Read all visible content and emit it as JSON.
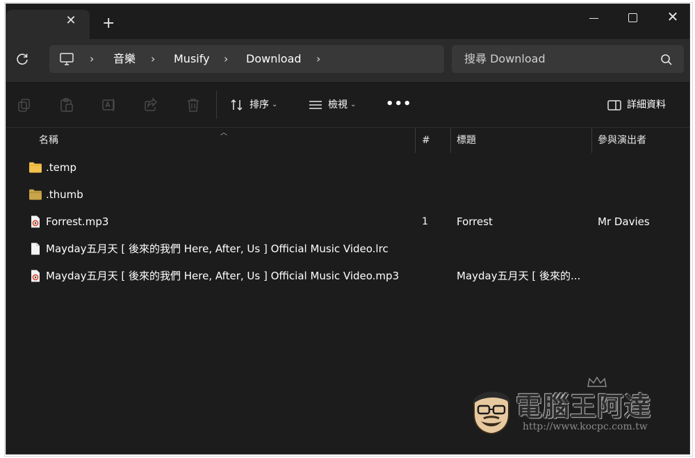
{
  "window": {
    "tab_close": "✕",
    "new_tab": "+",
    "close_glyph": "✕"
  },
  "breadcrumb": {
    "items": [
      "音樂",
      "Musify",
      "Download"
    ],
    "separator": "›"
  },
  "search": {
    "placeholder": "搜尋 Download"
  },
  "toolbar": {
    "sort_label": "排序",
    "view_label": "檢視",
    "more_label": "•••",
    "details_label": "詳細資料"
  },
  "columns": {
    "name": "名稱",
    "number": "#",
    "title": "標題",
    "artist": "參與演出者"
  },
  "files": [
    {
      "name": ".temp",
      "type": "folder",
      "number": "",
      "title": "",
      "artist": ""
    },
    {
      "name": ".thumb",
      "type": "folder",
      "number": "",
      "title": "",
      "artist": ""
    },
    {
      "name": "Forrest.mp3",
      "type": "audio",
      "number": "1",
      "title": "Forrest",
      "artist": "Mr Davies"
    },
    {
      "name": "Mayday五月天 [ 後來的我們 Here, After, Us ] Official Music Video.lrc",
      "type": "file",
      "number": "",
      "title": "",
      "artist": ""
    },
    {
      "name": "Mayday五月天 [ 後來的我們 Here, After, Us ] Official Music Video.mp3",
      "type": "audio",
      "number": "",
      "title": "Mayday五月天 [ 後來的...",
      "artist": ""
    }
  ],
  "watermark": {
    "title": "電腦王阿達",
    "url": "http://www.kocpc.com.tw"
  },
  "colors": {
    "background": "#1c1c1c",
    "folder": "#f2c14e",
    "folder_dim": "#c9a449",
    "audio_accent": "#d8452e"
  }
}
